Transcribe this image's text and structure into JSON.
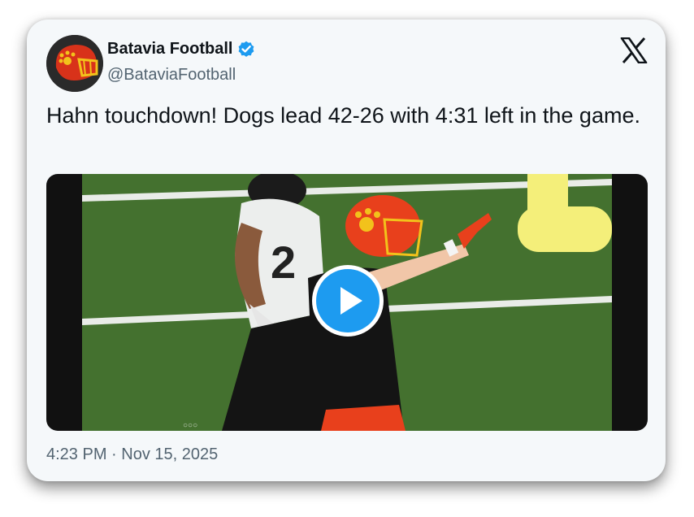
{
  "account": {
    "display_name": "Batavia Football",
    "handle": "@BataviaFootball",
    "verified": true
  },
  "tweet": {
    "text": "Hahn touchdown! Dogs lead 42-26 with 4:31 left in the game.",
    "timestamp": "4:23 PM · Nov 15, 2025"
  },
  "media": {
    "type": "video",
    "play_icon": "play-icon",
    "jersey_number": "2"
  },
  "icons": {
    "brand": "x-logo-icon",
    "verified": "verified-badge-icon"
  },
  "colors": {
    "accent": "#1d9bf0",
    "helmet": "#e8401c",
    "field": "#3f6b2c"
  }
}
